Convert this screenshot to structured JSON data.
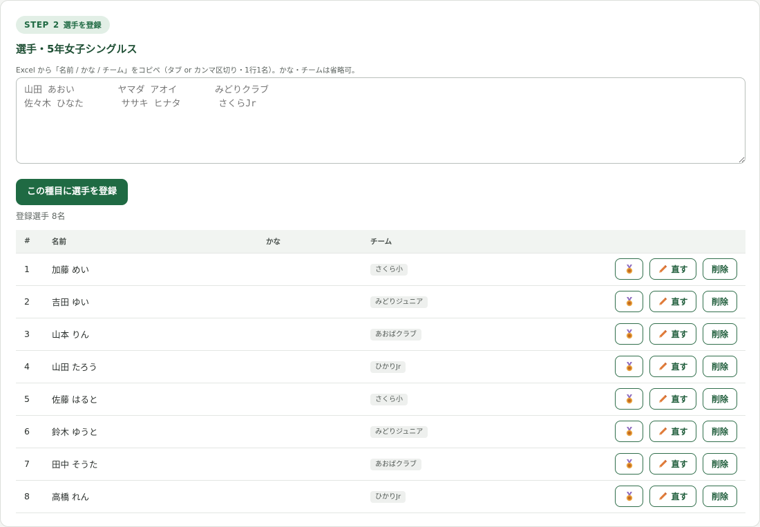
{
  "step": {
    "label": "STEP",
    "number": "2",
    "sub": "選手を登録"
  },
  "title": "選手・5年女子シングルス",
  "hint": "Excel から「名前 / かな / チーム」をコピペ（タブ or カンマ区切り・1行1名）。かな・チームは省略可。",
  "paste": {
    "placeholder": "山田 あおい        ヤマダ アオイ       みどりクラブ\n佐々木 ひなた       ササキ ヒナタ       さくらJr"
  },
  "register_button": "この種目に選手を登録",
  "count_text": "登録選手 8名",
  "table": {
    "headers": {
      "num": "#",
      "name": "名前",
      "kana": "かな",
      "team": "チーム"
    },
    "rows": [
      {
        "num": "1",
        "name": "加藤 めい",
        "kana": "",
        "team": "さくら小"
      },
      {
        "num": "2",
        "name": "吉田 ゆい",
        "kana": "",
        "team": "みどりジュニア"
      },
      {
        "num": "3",
        "name": "山本 りん",
        "kana": "",
        "team": "あおばクラブ"
      },
      {
        "num": "4",
        "name": "山田 たろう",
        "kana": "",
        "team": "ひかりJr"
      },
      {
        "num": "5",
        "name": "佐藤 はると",
        "kana": "",
        "team": "さくら小"
      },
      {
        "num": "6",
        "name": "鈴木 ゆうと",
        "kana": "",
        "team": "みどりジュニア"
      },
      {
        "num": "7",
        "name": "田中 そうた",
        "kana": "",
        "team": "あおばクラブ"
      },
      {
        "num": "8",
        "name": "高橋 れん",
        "kana": "",
        "team": "ひかりJr"
      }
    ]
  },
  "actions": {
    "medal_icon": "medal-icon",
    "edit_label": "直す",
    "edit_icon": "pencil-icon",
    "delete_label": "削除"
  },
  "colors": {
    "accent": "#1f6a43",
    "pill_bg": "#e2efe6",
    "title": "#1e4f34",
    "medal": "#d9853b",
    "pencil": "#e07b39"
  }
}
